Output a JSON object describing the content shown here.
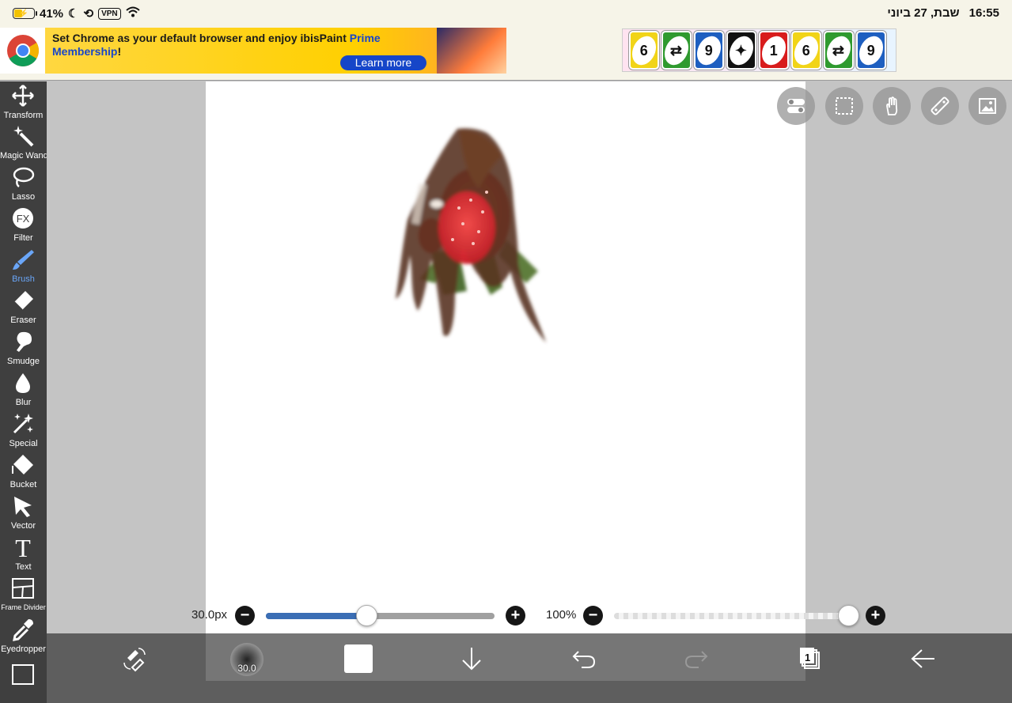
{
  "status_bar": {
    "battery_percent": "41%",
    "vpn_label": "VPN",
    "date": "שבת, 27 ביוני",
    "time": "16:55"
  },
  "ad_banner": {
    "text_part1": "Set Chrome as your default browser and enjoy ibisPaint ",
    "text_highlight": "Prime Membership",
    "text_part2": "!",
    "cta": "Learn more"
  },
  "uno_ad": {
    "cards": [
      {
        "label": "6",
        "color": "#f1d418"
      },
      {
        "label": "⇄",
        "color": "#2f9a2f"
      },
      {
        "label": "9",
        "color": "#1e5fc0"
      },
      {
        "label": "✦",
        "color": "#111111"
      },
      {
        "label": "1",
        "color": "#d81c1c"
      },
      {
        "label": "6",
        "color": "#f1d418"
      },
      {
        "label": "⇄",
        "color": "#2f9a2f"
      },
      {
        "label": "9",
        "color": "#1e5fc0"
      }
    ]
  },
  "toolbar": {
    "items": [
      {
        "label": "Transform",
        "icon": "transform-icon"
      },
      {
        "label": "Magic Wand",
        "icon": "magic-wand-icon"
      },
      {
        "label": "Lasso",
        "icon": "lasso-icon"
      },
      {
        "label": "Filter",
        "icon": "filter-icon"
      },
      {
        "label": "Brush",
        "icon": "brush-icon"
      },
      {
        "label": "Eraser",
        "icon": "eraser-icon"
      },
      {
        "label": "Smudge",
        "icon": "smudge-icon"
      },
      {
        "label": "Blur",
        "icon": "blur-icon"
      },
      {
        "label": "Special",
        "icon": "special-icon"
      },
      {
        "label": "Bucket",
        "icon": "bucket-icon"
      },
      {
        "label": "Vector",
        "icon": "vector-icon"
      },
      {
        "label": "Text",
        "icon": "text-icon"
      },
      {
        "label": "Frame Divider",
        "icon": "frame-divider-icon"
      },
      {
        "label": "Eyedropper",
        "icon": "eyedropper-icon"
      }
    ],
    "active": "Brush",
    "filter_glyph": "FX",
    "text_glyph": "T"
  },
  "sliders": {
    "brush_size_label": "30.0px",
    "brush_size_fraction": 0.44,
    "opacity_label": "100%",
    "opacity_fraction": 1.0,
    "minus": "−",
    "plus": "+"
  },
  "bottom_bar": {
    "brush_preview_value": "30.0",
    "layer_count": "1"
  },
  "colors": {
    "toolbar_bg": "#3f3f3f",
    "active_tool": "#6aa6f8",
    "slider_fill": "#3b6eb5",
    "canvas_bg": "#ffffff",
    "bottom_bar_bg": "#5e5e5e"
  }
}
